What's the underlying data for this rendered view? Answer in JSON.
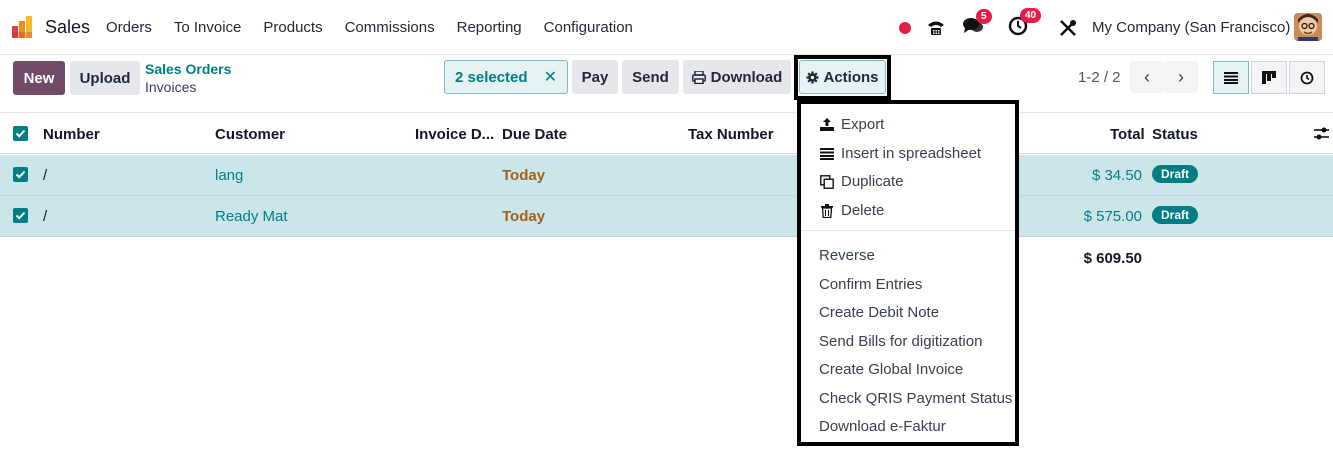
{
  "navbar": {
    "app_name": "Sales",
    "menu": [
      "Orders",
      "To Invoice",
      "Products",
      "Commissions",
      "Reporting",
      "Configuration"
    ],
    "chat_badge": "5",
    "activity_badge": "40",
    "company": "My Company (San Francisco)"
  },
  "control": {
    "new_label": "New",
    "upload_label": "Upload",
    "breadcrumb_parent": "Sales Orders",
    "breadcrumb_current": "Invoices",
    "selected_label": "2 selected",
    "selected_clear": "✕",
    "pay_label": "Pay",
    "send_label": "Send",
    "download_label": "Download",
    "actions_label": "Actions",
    "pager": "1-2 / 2"
  },
  "table": {
    "headers": {
      "number": "Number",
      "customer": "Customer",
      "invoice_date": "Invoice D...",
      "due_date": "Due Date",
      "tax_number": "Tax Number",
      "total": "Total",
      "status": "Status"
    },
    "rows": [
      {
        "number": "/",
        "customer": "lang",
        "due": "Today",
        "total": "$ 34.50",
        "status": "Draft"
      },
      {
        "number": "/",
        "customer": "Ready Mat",
        "due": "Today",
        "total": "$ 575.00",
        "status": "Draft"
      }
    ],
    "grand_total": "$ 609.50"
  },
  "actions_menu": {
    "top": [
      "Export",
      "Insert in spreadsheet",
      "Duplicate",
      "Delete"
    ],
    "bottom": [
      "Reverse",
      "Confirm Entries",
      "Create Debit Note",
      "Send Bills for digitization",
      "Create Global Invoice",
      "Check QRIS Payment Status",
      "Download e-Faktur"
    ]
  },
  "colors": {
    "brand": "#714b67",
    "accent": "#017e84",
    "selected_row": "#cbe6e8",
    "badge_red": "#e11d48",
    "due_today": "#a35f1c"
  },
  "icons": [
    "sales-logo-icon",
    "record-dot-icon",
    "phone-icon",
    "chat-icon",
    "activity-clock-icon",
    "tools-icon",
    "gear-icon",
    "printer-icon",
    "upload-icon",
    "list-icon",
    "copy-icon",
    "trash-icon",
    "chevron-left-icon",
    "chevron-right-icon",
    "list-view-icon",
    "kanban-view-icon",
    "activity-view-icon",
    "column-settings-icon",
    "checkbox-checked-icon"
  ]
}
